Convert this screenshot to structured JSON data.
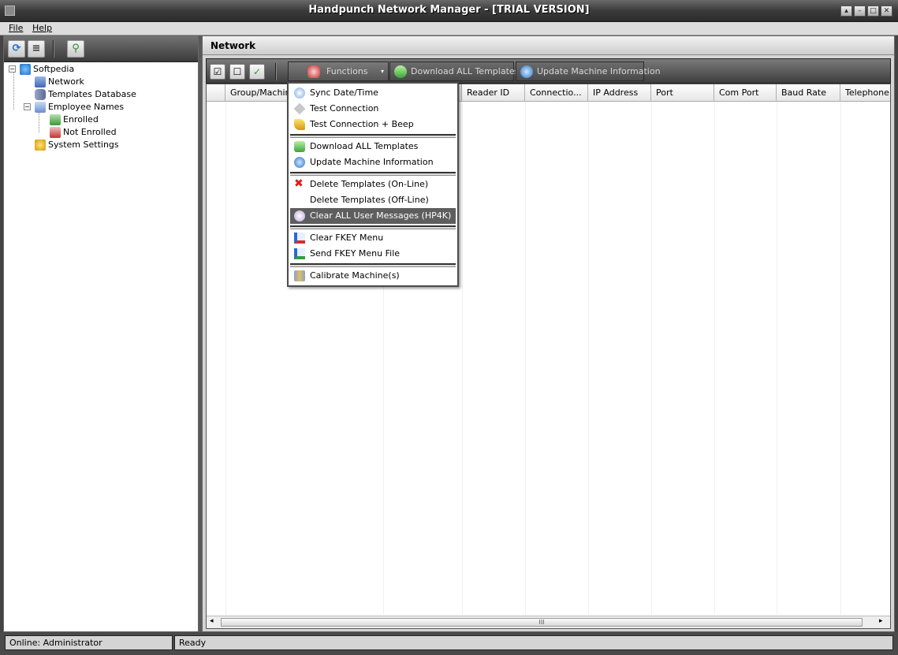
{
  "window": {
    "title": "Handpunch Network Manager - [TRIAL VERSION]"
  },
  "menubar": {
    "items": [
      "File",
      "Help"
    ]
  },
  "tree": {
    "root": "Softpedia",
    "items": [
      "Network",
      "Templates Database",
      "Employee Names",
      "Enrolled",
      "Not Enrolled",
      "System Settings"
    ]
  },
  "panel": {
    "title": "Network"
  },
  "toolbar": {
    "functions_label": "Functions",
    "download_label": "Download ALL Templates",
    "update_label": "Update Machine Information"
  },
  "grid": {
    "columns": [
      "Group/Machine",
      "Reader ID",
      "Connectio...",
      "IP Address",
      "Port",
      "Com Port",
      "Baud Rate",
      "Telephone"
    ],
    "scroll_grip": "III"
  },
  "functions_menu": {
    "items": [
      {
        "label": "Sync Date/Time",
        "icon": "sync-clock-icon"
      },
      {
        "label": "Test Connection",
        "icon": "test-diamond-icon"
      },
      {
        "label": "Test Connection + Beep",
        "icon": "beep-bell-icon"
      },
      {
        "label": "Download ALL Templates",
        "icon": "download-arrow-icon"
      },
      {
        "label": "Update Machine Information",
        "icon": "info-icon"
      },
      {
        "label": "Delete Templates (On-Line)",
        "icon": "red-x-icon"
      },
      {
        "label": "Delete Templates (Off-Line)",
        "icon": ""
      },
      {
        "label": "Clear ALL User Messages (HP4K)",
        "icon": "speech-bubble-icon"
      },
      {
        "label": "Clear FKEY Menu",
        "icon": "fkey-tree-icon"
      },
      {
        "label": "Send FKEY Menu File",
        "icon": "fkey-send-icon"
      },
      {
        "label": "Calibrate Machine(s)",
        "icon": "calibrate-icon"
      }
    ]
  },
  "status": {
    "user": "Online: Administrator",
    "state": "Ready"
  }
}
